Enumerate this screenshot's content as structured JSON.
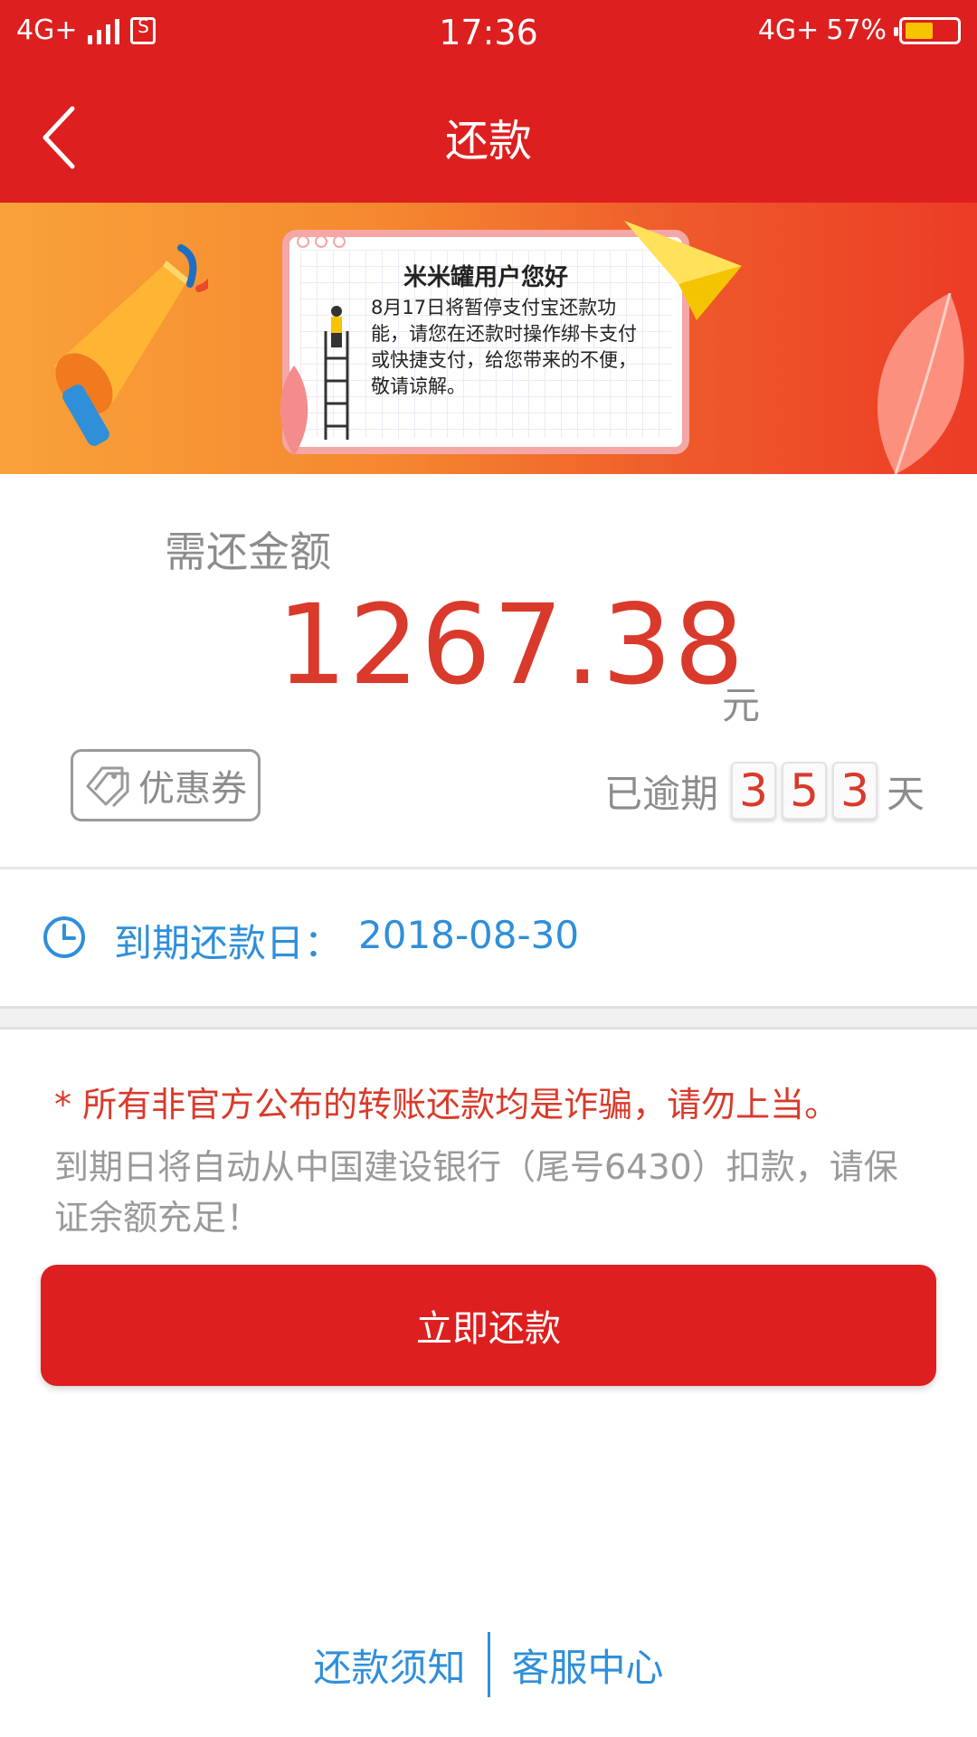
{
  "status_bar": {
    "network_left": "4G+",
    "time": "17:36",
    "network_right": "4G+",
    "battery": "57%",
    "battery_level": 0.57
  },
  "header": {
    "title": "还款"
  },
  "banner": {
    "card_title": "米米罐用户您好",
    "card_body": "8月17日将暂停支付宝还款功能，请您在还款时操作绑卡支付或快捷支付，给您带来的不便，敬请谅解。"
  },
  "amount": {
    "label": "需还金额",
    "value": "1267.38",
    "unit": "元"
  },
  "coupon": {
    "label": "优惠券"
  },
  "overdue": {
    "label": "已逾期",
    "digits": [
      "3",
      "5",
      "3"
    ],
    "unit": "天"
  },
  "due": {
    "label": "到期还款日：",
    "date": "2018-08-30"
  },
  "notice": {
    "warning": "* 所有非官方公布的转账还款均是诈骗，请勿上当。",
    "info": "到期日将自动从中国建设银行（尾号6430）扣款，请保证余额充足！"
  },
  "actions": {
    "pay_now": "立即还款"
  },
  "footer": {
    "repay_notes": "还款须知",
    "customer_service": "客服中心"
  },
  "colors": {
    "brand_red": "#de1f1f",
    "amount_red": "#d93a2b",
    "link_blue": "#2f8fd9"
  }
}
